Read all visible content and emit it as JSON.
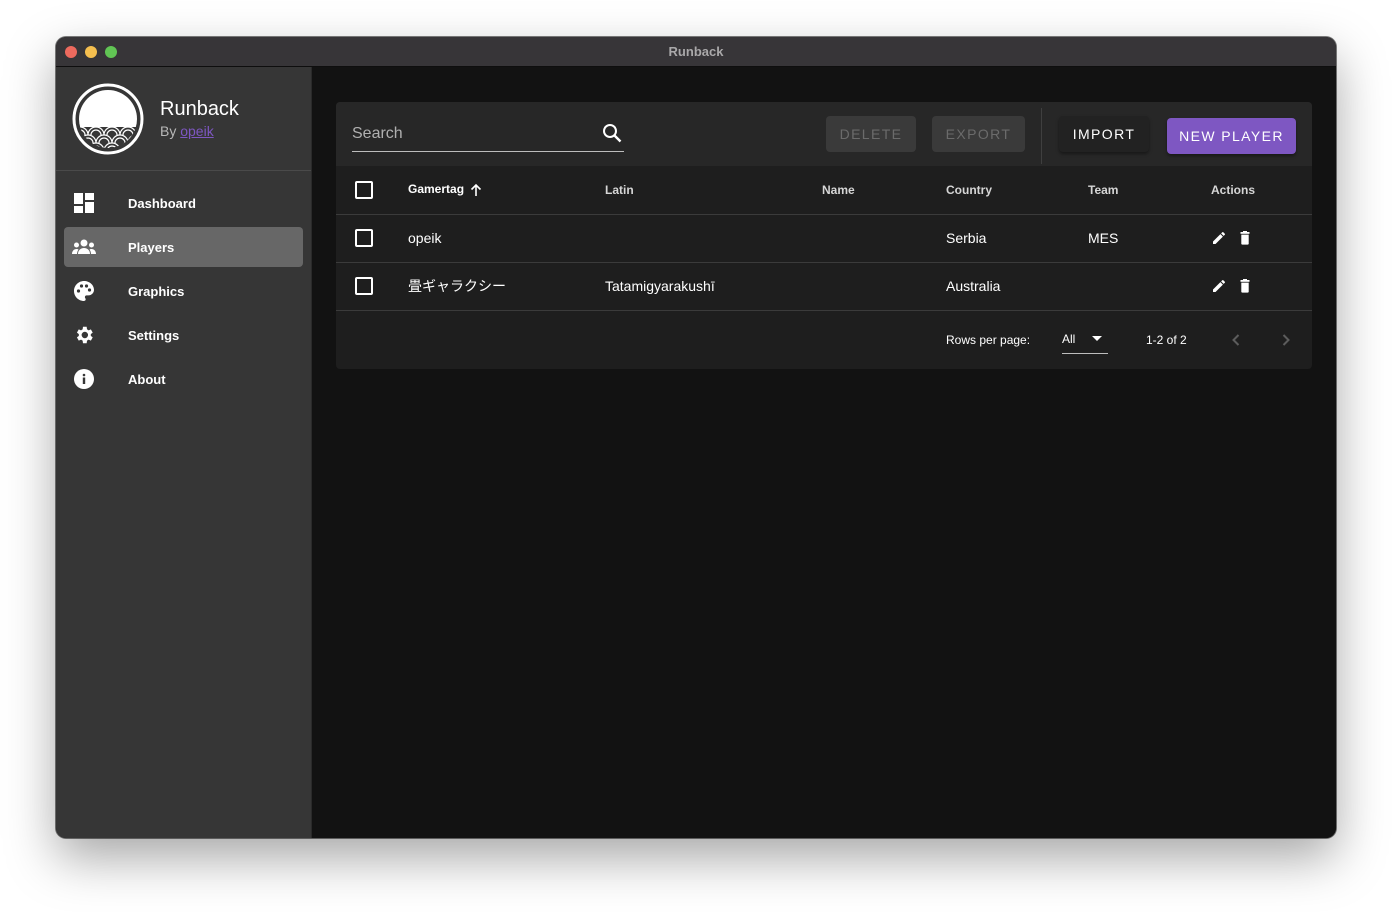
{
  "window": {
    "title": "Runback"
  },
  "brand": {
    "name": "Runback",
    "by_prefix": "By",
    "author": "opeik",
    "accent_color": "#7e57c2"
  },
  "sidebar": {
    "items": [
      {
        "label": "Dashboard",
        "icon": "dashboard-icon",
        "active": false
      },
      {
        "label": "Players",
        "icon": "people-icon",
        "active": true
      },
      {
        "label": "Graphics",
        "icon": "palette-icon",
        "active": false
      },
      {
        "label": "Settings",
        "icon": "gear-icon",
        "active": false
      },
      {
        "label": "About",
        "icon": "info-icon",
        "active": false
      }
    ]
  },
  "toolbar": {
    "search_placeholder": "Search",
    "search_value": "",
    "delete_label": "DELETE",
    "export_label": "EXPORT",
    "import_label": "IMPORT",
    "new_player_label": "NEW PLAYER"
  },
  "table": {
    "columns": [
      {
        "label": "Gamertag",
        "sort": "asc"
      },
      {
        "label": "Latin"
      },
      {
        "label": "Name"
      },
      {
        "label": "Country"
      },
      {
        "label": "Team"
      },
      {
        "label": "Actions"
      }
    ],
    "rows": [
      {
        "gamertag": "opeik",
        "latin": "",
        "name": "",
        "country": "Serbia",
        "team": "MES",
        "selected": false
      },
      {
        "gamertag": "畳ギャラクシー",
        "latin": "Tatamigyarakushī",
        "name": "",
        "country": "Australia",
        "team": "",
        "selected": false
      }
    ]
  },
  "pagination": {
    "rows_per_page_label": "Rows per page:",
    "rows_per_page_value": "All",
    "range_text": "1-2 of 2"
  }
}
